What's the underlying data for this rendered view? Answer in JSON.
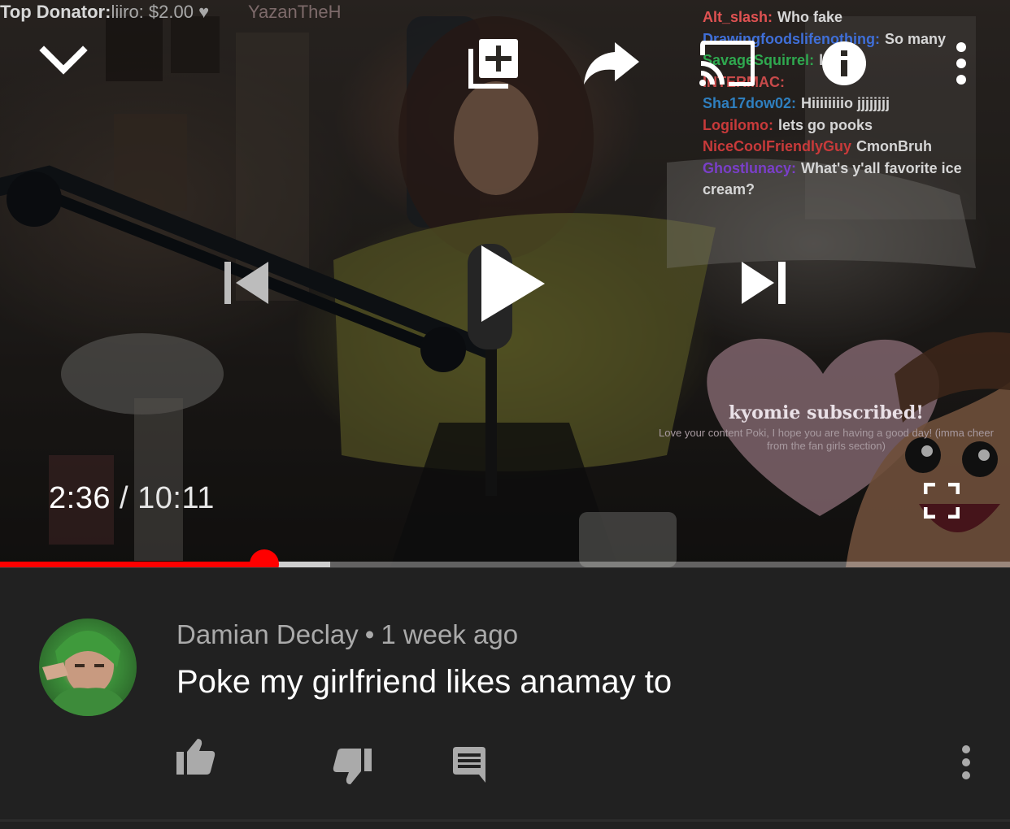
{
  "player": {
    "stream_overlay": {
      "top_donator_label": "Top Donator:",
      "top_donator_value": "liiro: $2.00 ♥",
      "viewer_name": "YazanTheH"
    },
    "chat": [
      {
        "user": "Alt_slash:",
        "message": "Who fake",
        "color": "#e05252"
      },
      {
        "user": "Drawingfoodslifenothing:",
        "message": "So many",
        "color": "#3f6fd8"
      },
      {
        "user": "SavageSquirrel:",
        "message": "lo",
        "color": "#2fa84f"
      },
      {
        "user": "INTERMAC:",
        "message": "",
        "color": "#c84a4a"
      },
      {
        "user": "Sha17dow02:",
        "message": "Hiiiiiiiio jjjjjjjj",
        "color": "#2f7fbf"
      },
      {
        "user": "Logilomo:",
        "message": "lets go pooks",
        "color": "#c83a3a"
      },
      {
        "user": "NiceCoolFriendlyGuy",
        "message": "CmonBruh",
        "color": "#c83a3a"
      },
      {
        "user": "Ghostlunacy:",
        "message": "What's y'all favorite ice cream?",
        "color": "#7a3fc8"
      }
    ],
    "sub_alert": {
      "title": "kyomie subscribed!",
      "message": "Love your content Poki, I hope you are having a good day! (imma cheer from the fan girls section)"
    },
    "time": {
      "current": "2:36",
      "separator": "/",
      "duration": "10:11"
    },
    "progress": {
      "played_fraction": 0.262,
      "buffered_fraction": 0.327
    },
    "icons": {
      "minimize": "chevron-down-icon",
      "add_to_playlist": "playlist-add-icon",
      "share": "share-icon",
      "cast": "cast-icon",
      "info": "info-icon",
      "more": "more-vert-icon",
      "previous": "skip-previous-icon",
      "play": "play-icon",
      "next": "skip-next-icon",
      "fullscreen": "fullscreen-icon"
    },
    "colors": {
      "progress_played": "#ff0000",
      "progress_buffered": "#cfcfcf"
    }
  },
  "comment": {
    "author": "Damian Declay",
    "dot": "•",
    "time_ago": "1 week ago",
    "text": "Poke my girlfriend likes anamay to",
    "actions": {
      "like": "thumb-up-icon",
      "dislike": "thumb-down-icon",
      "reply": "comment-icon",
      "more": "more-vert-icon"
    }
  }
}
